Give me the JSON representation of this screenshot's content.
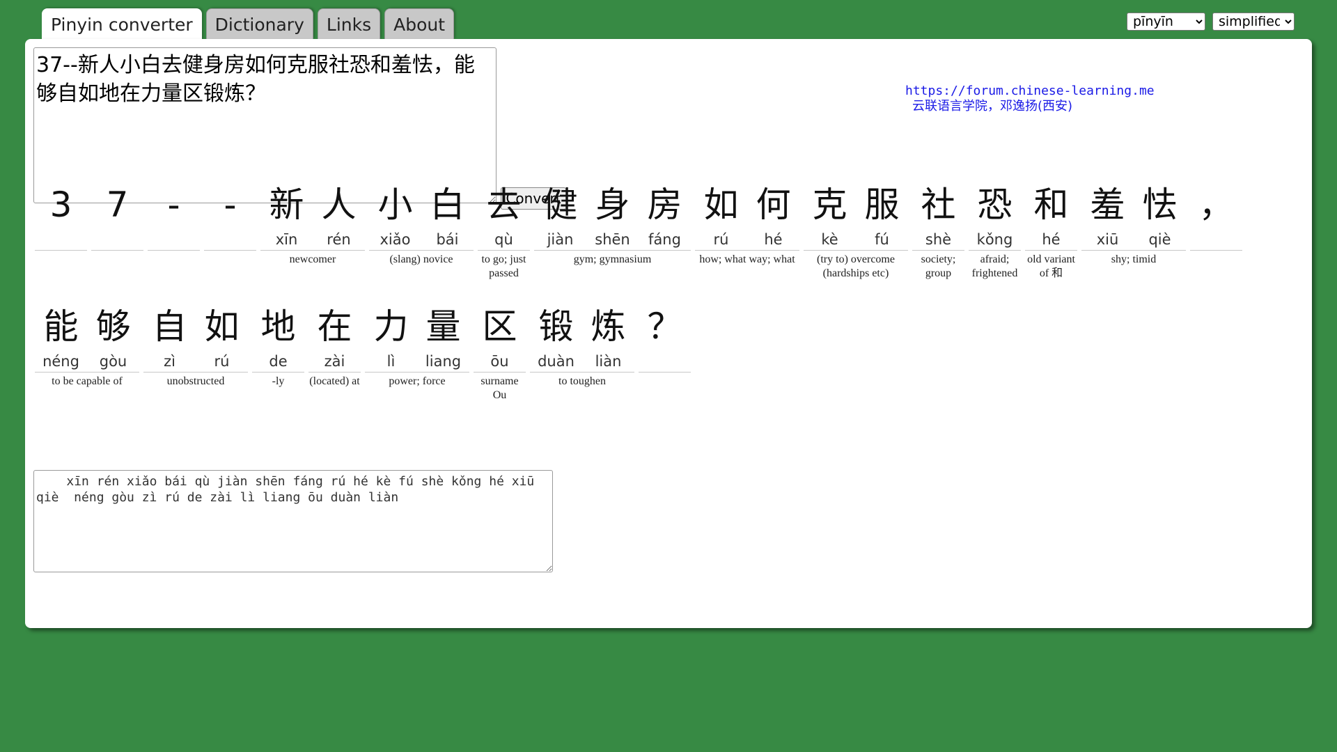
{
  "tabs": [
    {
      "label": "Pinyin converter",
      "active": true
    },
    {
      "label": "Dictionary",
      "active": false
    },
    {
      "label": "Links",
      "active": false
    },
    {
      "label": "About",
      "active": false
    }
  ],
  "script_select": {
    "selected": "pīnyīn"
  },
  "variant_select": {
    "selected": "simplified"
  },
  "input": {
    "value": "37--新人小白去健身房如何克服社恐和羞怯，能够自如地在力量区锻炼？"
  },
  "convert_label": "Convert",
  "credit": {
    "url": "https://forum.chinese-learning.me",
    "org": "云联语言学院，邓逸扬(西安)"
  },
  "result_rows": [
    {
      "words": [
        {
          "chars": [
            {
              "h": "3",
              "p": ""
            }
          ],
          "gloss": ""
        },
        {
          "chars": [
            {
              "h": "7",
              "p": ""
            }
          ],
          "gloss": ""
        },
        {
          "chars": [
            {
              "h": "-",
              "p": ""
            }
          ],
          "gloss": ""
        },
        {
          "chars": [
            {
              "h": "-",
              "p": ""
            }
          ],
          "gloss": ""
        },
        {
          "chars": [
            {
              "h": "新",
              "p": "xīn"
            },
            {
              "h": "人",
              "p": "rén"
            }
          ],
          "gloss": "newcomer"
        },
        {
          "chars": [
            {
              "h": "小",
              "p": "xiǎo"
            },
            {
              "h": "白",
              "p": "bái"
            }
          ],
          "gloss": "(slang) novice"
        },
        {
          "chars": [
            {
              "h": "去",
              "p": "qù"
            }
          ],
          "gloss": "to go; just passed"
        },
        {
          "chars": [
            {
              "h": "健",
              "p": "jiàn"
            },
            {
              "h": "身",
              "p": "shēn"
            },
            {
              "h": "房",
              "p": "fáng"
            }
          ],
          "gloss": "gym; gymnasium"
        },
        {
          "chars": [
            {
              "h": "如",
              "p": "rú"
            },
            {
              "h": "何",
              "p": "hé"
            }
          ],
          "gloss": "how; what way; what"
        },
        {
          "chars": [
            {
              "h": "克",
              "p": "kè"
            },
            {
              "h": "服",
              "p": "fú"
            }
          ],
          "gloss": "(try to) overcome (hardships etc)"
        },
        {
          "chars": [
            {
              "h": "社",
              "p": "shè"
            }
          ],
          "gloss": "society; group"
        },
        {
          "chars": [
            {
              "h": "恐",
              "p": "kǒng"
            }
          ],
          "gloss": "afraid; frightened"
        },
        {
          "chars": [
            {
              "h": "和",
              "p": "hé"
            }
          ],
          "gloss": "old variant of 和"
        },
        {
          "chars": [
            {
              "h": "羞",
              "p": "xiū"
            },
            {
              "h": "怯",
              "p": "qiè"
            }
          ],
          "gloss": "shy; timid"
        },
        {
          "chars": [
            {
              "h": "，",
              "p": ""
            }
          ],
          "gloss": ""
        }
      ]
    },
    {
      "words": [
        {
          "chars": [
            {
              "h": "能",
              "p": "néng"
            },
            {
              "h": "够",
              "p": "gòu"
            }
          ],
          "gloss": "to be capable of"
        },
        {
          "chars": [
            {
              "h": "自",
              "p": "zì"
            },
            {
              "h": "如",
              "p": "rú"
            }
          ],
          "gloss": "unobstructed"
        },
        {
          "chars": [
            {
              "h": "地",
              "p": "de"
            }
          ],
          "gloss": "-ly"
        },
        {
          "chars": [
            {
              "h": "在",
              "p": "zài"
            }
          ],
          "gloss": "(located) at"
        },
        {
          "chars": [
            {
              "h": "力",
              "p": "lì"
            },
            {
              "h": "量",
              "p": "liang"
            }
          ],
          "gloss": "power; force"
        },
        {
          "chars": [
            {
              "h": "区",
              "p": "ōu"
            }
          ],
          "gloss": "surname Ou"
        },
        {
          "chars": [
            {
              "h": "锻",
              "p": "duàn"
            },
            {
              "h": "炼",
              "p": "liàn"
            }
          ],
          "gloss": "to toughen"
        },
        {
          "chars": [
            {
              "h": "？",
              "p": ""
            }
          ],
          "gloss": ""
        }
      ]
    }
  ],
  "output": {
    "value": "    xīn rén xiǎo bái qù jiàn shēn fáng rú hé kè fú shè kǒng hé xiū qiè  néng gòu zì rú de zài lì liang ōu duàn liàn"
  }
}
